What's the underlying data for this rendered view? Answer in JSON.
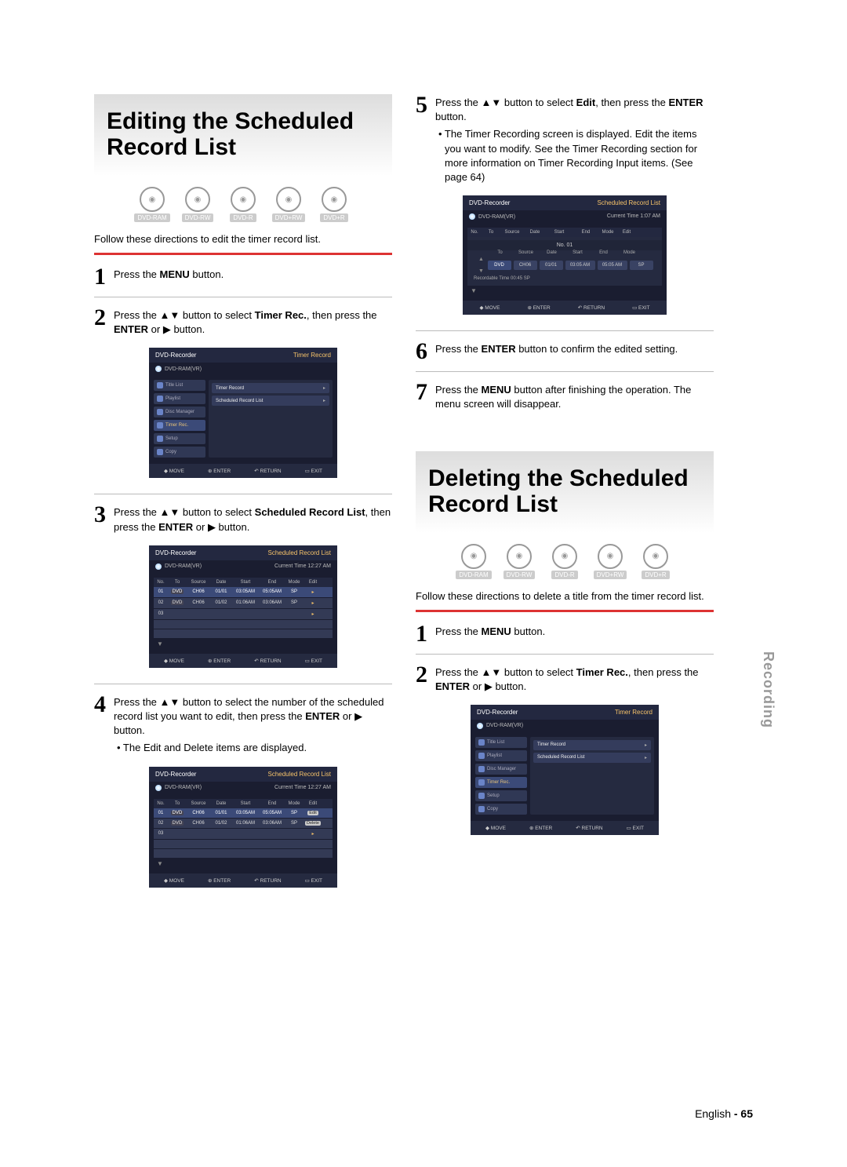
{
  "sectionA": {
    "title": "Editing the Scheduled Record List",
    "discs": [
      "DVD-RAM",
      "DVD-RW",
      "DVD-R",
      "DVD+RW",
      "DVD+R"
    ],
    "intro": "Follow these directions to edit the timer record list.",
    "step1": "Press the MENU button.",
    "step2_a": "Press the ▲▼ button to select ",
    "step2_b": "Timer Rec.",
    "step2_c": ", then press the ",
    "step2_d": "ENTER",
    "step2_e": " or ▶ button.",
    "step3_a": "Press the ▲▼ button to select ",
    "step3_b": "Scheduled Record List",
    "step3_c": ", then press the ",
    "step3_d": "ENTER",
    "step3_e": " or ▶ button.",
    "step4_a": "Press the ▲▼ button to select the number of the scheduled record list you want to edit, then press the ",
    "step4_b": "ENTER",
    "step4_c": " or ▶ button.",
    "step4_bullet": "• The Edit and Delete items are displayed.",
    "step5_a": "Press the ▲▼ button to select ",
    "step5_b": "Edit",
    "step5_c": ", then press the ",
    "step5_d": "ENTER",
    "step5_e": " button.",
    "step5_bullet": "• The Timer Recording screen is displayed. Edit the items you want to modify. See the Timer Recording section for more information on Timer Recording Input items. (See page 64)",
    "step6_a": "Press the ",
    "step6_b": "ENTER",
    "step6_c": " button to confirm the edited setting.",
    "step7_a": "Press the ",
    "step7_b": "MENU",
    "step7_c": " button after finishing the operation. The menu screen will disappear."
  },
  "sectionB": {
    "title": "Deleting the Scheduled Record List",
    "discs": [
      "DVD-RAM",
      "DVD-RW",
      "DVD-R",
      "DVD+RW",
      "DVD+R"
    ],
    "intro": "Follow these directions to delete a title from the timer record list.",
    "step1": "Press the MENU button.",
    "step2_a": "Press the ▲▼ button to select ",
    "step2_b": "Timer Rec.",
    "step2_c": ", then press the ",
    "step2_d": "ENTER",
    "step2_e": " or ▶ button."
  },
  "osd": {
    "recorder": "DVD-Recorder",
    "timerRecord": "Timer Record",
    "schedList": "Scheduled Record List",
    "media": "DVD-RAM(VR)",
    "time1227": "Current Time  12:27 AM",
    "time107": "Current Time  1:07 AM",
    "nav": [
      "Title List",
      "Playlist",
      "Disc Manager",
      "Timer Rec.",
      "Setup",
      "Copy"
    ],
    "navSel": 3,
    "menuItems": [
      "Timer Record",
      "Scheduled Record List"
    ],
    "foot": [
      "◆ MOVE",
      "⊕ ENTER",
      "↶ RETURN",
      "▭ EXIT"
    ],
    "headers": [
      "No.",
      "To",
      "Source",
      "Date",
      "Start",
      "End",
      "Mode",
      "Edit"
    ],
    "rows": [
      {
        "no": "01",
        "to": "DVD",
        "src": "CH06",
        "date": "01/01",
        "start": "03:05AM",
        "end": "05:05AM",
        "mode": "SP"
      },
      {
        "no": "02",
        "to": "DVD",
        "src": "CH06",
        "date": "01/02",
        "start": "01:06AM",
        "end": "03:06AM",
        "mode": "SP"
      },
      {
        "no": "03"
      }
    ],
    "editLabel": "Edit",
    "deleteLabel": "Delete",
    "formTitle": "No. 01",
    "formHead": [
      "To",
      "Source",
      "Date",
      "Start",
      "End",
      "Mode"
    ],
    "formVals": [
      "DVD",
      "CH06",
      "01/01",
      "03:05 AM",
      "05:05 AM",
      "SP"
    ],
    "recTime": "Recordable Time    00:45   SP"
  },
  "tab": "Recording",
  "footer_a": "English",
  "footer_b": " - 65"
}
